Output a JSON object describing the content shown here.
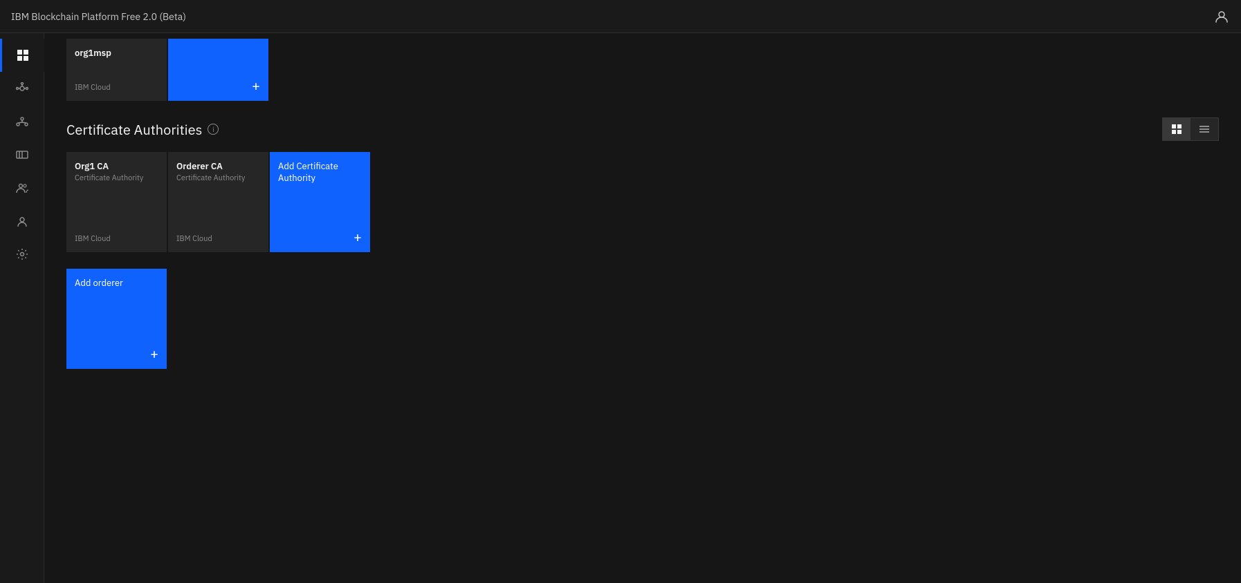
{
  "app": {
    "title": "IBM Blockchain Platform Free 2.0 (Beta)"
  },
  "sidebar": {
    "items": [
      {
        "id": "dashboard",
        "label": "Dashboard",
        "active": true
      },
      {
        "id": "network",
        "label": "Network",
        "active": false
      },
      {
        "id": "organizations",
        "label": "Organizations",
        "active": false
      },
      {
        "id": "channels",
        "label": "Channels",
        "active": false
      },
      {
        "id": "members",
        "label": "Members",
        "active": false
      },
      {
        "id": "identity",
        "label": "Identity",
        "active": false
      },
      {
        "id": "settings",
        "label": "Settings",
        "active": false
      }
    ]
  },
  "top_section": {
    "card": {
      "name": "org1msp",
      "cloud": "IBM Cloud"
    }
  },
  "certificate_authorities": {
    "section_title": "Certificate Authorities",
    "view_grid_label": "Grid view",
    "view_list_label": "List view",
    "cards": [
      {
        "id": "org1ca",
        "name": "Org1 CA",
        "type": "Certificate Authority",
        "cloud": "IBM Cloud"
      },
      {
        "id": "ordererca",
        "name": "Orderer CA",
        "type": "Certificate Authority",
        "cloud": "IBM Cloud"
      }
    ],
    "add_card_label": "Add Certificate Authority"
  },
  "orderers": {
    "add_card_label": "Add orderer"
  },
  "icons": {
    "plus": "+",
    "info": "i",
    "user": "👤",
    "grid": "⊞",
    "list": "≡"
  }
}
